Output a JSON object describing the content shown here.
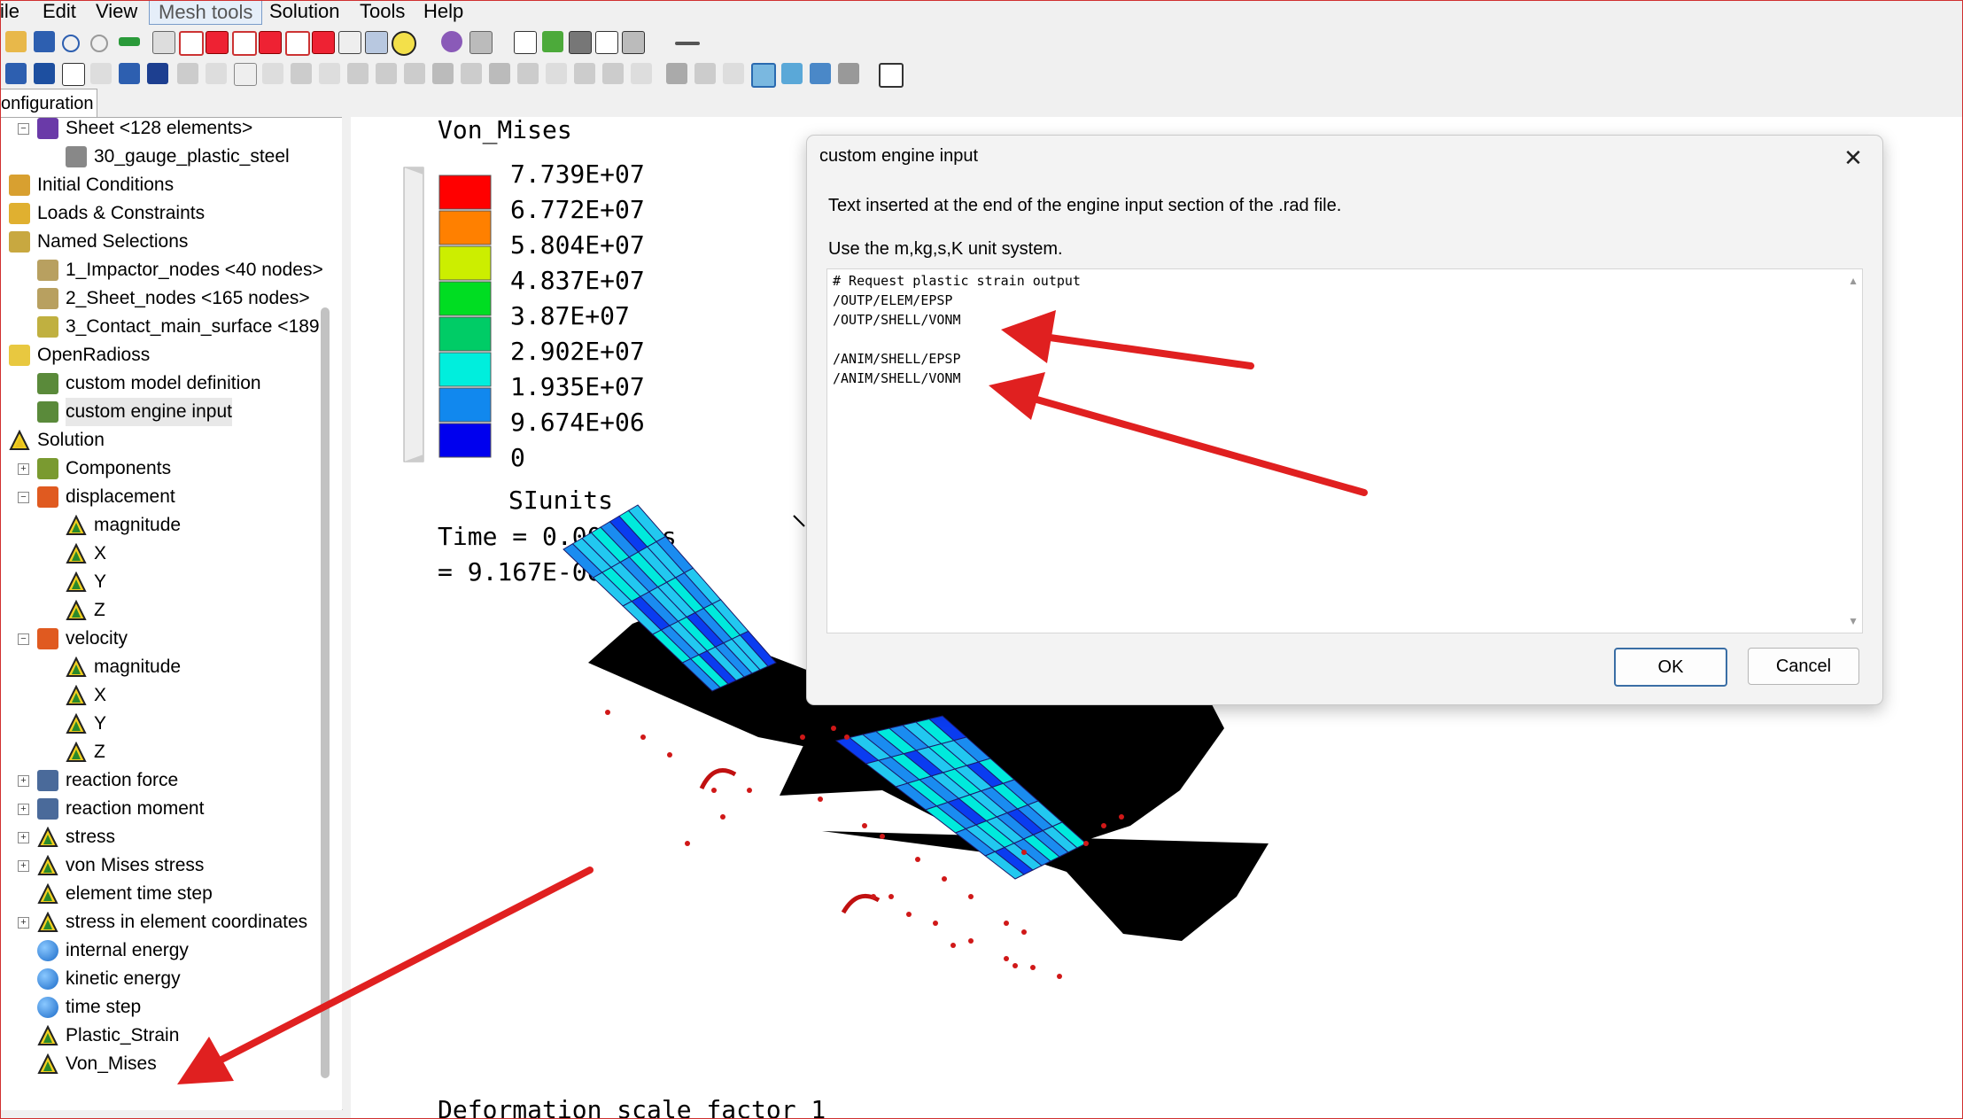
{
  "menubar": {
    "items": [
      "ile",
      "Edit",
      "View",
      "Mesh tools",
      "Solution",
      "Tools",
      "Help"
    ],
    "active_item": "Mesh tools"
  },
  "panel_tab": "onfiguration",
  "tree": {
    "items": [
      {
        "label": "Sheet <128 elements>",
        "icon": "part-icon"
      },
      {
        "label": "30_gauge_plastic_steel",
        "icon": "material-icon"
      },
      {
        "label": "Initial Conditions",
        "icon": "initial-conditions-icon"
      },
      {
        "label": "Loads & Constraints",
        "icon": "loads-icon"
      },
      {
        "label": "Named Selections",
        "icon": "named-selection-icon"
      },
      {
        "label": "1_Impactor_nodes <40 nodes>",
        "icon": "node-set-icon"
      },
      {
        "label": "2_Sheet_nodes <165 nodes>",
        "icon": "node-set-icon"
      },
      {
        "label": "3_Contact_main_surface <189",
        "icon": "surface-set-icon"
      },
      {
        "label": "OpenRadioss",
        "icon": "rad-icon"
      },
      {
        "label": "custom model definition",
        "icon": "rad-text-icon"
      },
      {
        "label": "custom engine input",
        "icon": "rad-text-icon"
      },
      {
        "label": "Solution",
        "icon": "solution-icon"
      },
      {
        "label": "Components",
        "icon": "components-icon"
      },
      {
        "label": "displacement",
        "icon": "vector-icon"
      },
      {
        "label": "magnitude",
        "icon": "contour-icon"
      },
      {
        "label": "X",
        "icon": "contour-icon"
      },
      {
        "label": "Y",
        "icon": "contour-icon"
      },
      {
        "label": "Z",
        "icon": "contour-icon"
      },
      {
        "label": "velocity",
        "icon": "vector-icon"
      },
      {
        "label": "magnitude",
        "icon": "contour-icon"
      },
      {
        "label": "X",
        "icon": "contour-icon"
      },
      {
        "label": "Y",
        "icon": "contour-icon"
      },
      {
        "label": "Z",
        "icon": "contour-icon"
      },
      {
        "label": "reaction force",
        "icon": "reaction-icon"
      },
      {
        "label": "reaction moment",
        "icon": "reaction-icon"
      },
      {
        "label": "stress",
        "icon": "contour-icon"
      },
      {
        "label": "von Mises stress",
        "icon": "contour-icon"
      },
      {
        "label": "element time step",
        "icon": "contour-icon"
      },
      {
        "label": "stress in element coordinates",
        "icon": "contour-icon"
      },
      {
        "label": "internal energy",
        "icon": "energy-sphere-icon"
      },
      {
        "label": "kinetic energy",
        "icon": "energy-sphere-icon"
      },
      {
        "label": "time step",
        "icon": "energy-sphere-icon"
      },
      {
        "label": "Plastic_Strain",
        "icon": "contour-icon"
      },
      {
        "label": "Von_Mises",
        "icon": "contour-icon"
      }
    ],
    "selected": "custom engine input"
  },
  "legend": {
    "title": "Von_Mises",
    "values": [
      "7.739E+07",
      "6.772E+07",
      "5.804E+07",
      "4.837E+07",
      "3.87E+07",
      "2.902E+07",
      "1.935E+07",
      "9.674E+06",
      "0"
    ],
    "colors": [
      "#ff0000",
      "#ff8000",
      "#ccee00",
      "#66dd00",
      "#00dd22",
      "#00cc66",
      "#00eedd",
      "#1188ee",
      "#0000ee"
    ],
    "units": "SIunits",
    "time_line1": "Time = 0.00055 s",
    "time_line2": "= 9.167E-06 min",
    "footer": "Deformation scale factor 1"
  },
  "dialog": {
    "title": "custom engine input",
    "description": "Text inserted at the end of the engine input section of the .rad file.",
    "units_note": "Use the m,kg,s,K unit system.",
    "engine_text": "# Request plastic strain output\n/OUTP/ELEM/EPSP\n/OUTP/SHELL/VONM\n\n/ANIM/SHELL/EPSP\n/ANIM/SHELL/VONM",
    "ok_label": "OK",
    "cancel_label": "Cancel",
    "close_glyph": "✕"
  },
  "colors": {
    "annotation_arrow": "#e02020",
    "mesh_edge": "#000000",
    "node_marker": "#d01818"
  }
}
